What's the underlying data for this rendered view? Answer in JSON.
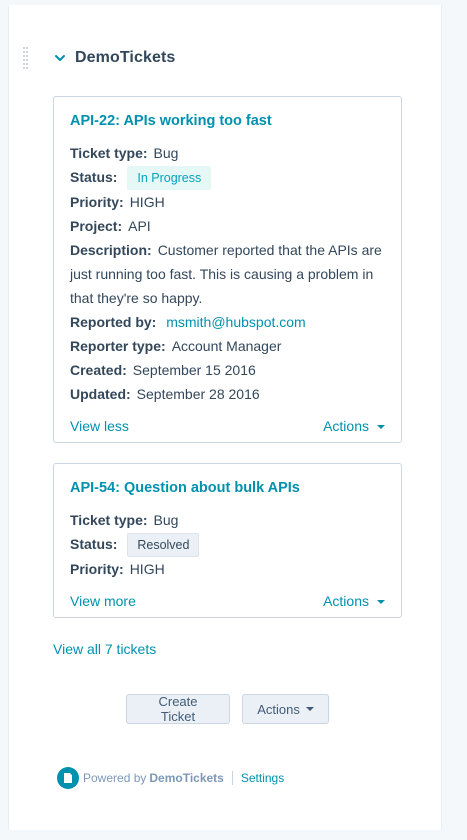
{
  "header": {
    "title": "DemoTickets"
  },
  "cards": [
    {
      "title": "API-22: APIs working too fast",
      "ticket_type_label": "Ticket type:",
      "ticket_type": "Bug",
      "status_label": "Status:",
      "status": "In Progress",
      "priority_label": "Priority:",
      "priority": "HIGH",
      "project_label": "Project:",
      "project": "API",
      "description_label": "Description:",
      "description": "Customer reported that the APIs are just running too fast. This is causing a problem in that they're so happy.",
      "reported_by_label": "Reported by:",
      "reported_by": "msmith@hubspot.com",
      "reporter_type_label": "Reporter type:",
      "reporter_type": "Account Manager",
      "created_label": "Created:",
      "created": "September 15 2016",
      "updated_label": "Updated:",
      "updated": "September 28 2016",
      "toggle_label": "View less",
      "actions_label": "Actions"
    },
    {
      "title": "API-54: Question about bulk APIs",
      "ticket_type_label": "Ticket type:",
      "ticket_type": "Bug",
      "status_label": "Status:",
      "status": "Resolved",
      "priority_label": "Priority:",
      "priority": "HIGH",
      "toggle_label": "View more",
      "actions_label": "Actions"
    }
  ],
  "view_all_label": "View all 7 tickets",
  "buttons": {
    "create_label": "Create Ticket",
    "actions_label": "Actions"
  },
  "footer": {
    "powered_by": "Powered by",
    "brand": "DemoTickets",
    "settings_label": "Settings"
  },
  "colors": {
    "link": "#0091ae",
    "text": "#33475b",
    "in_progress_bg": "#e5f8f6",
    "resolved_bg": "#eaf0f6"
  },
  "icons": {
    "drag": "drag-handle-icon",
    "chevron": "chevron-down-icon",
    "logo": "document-icon"
  }
}
